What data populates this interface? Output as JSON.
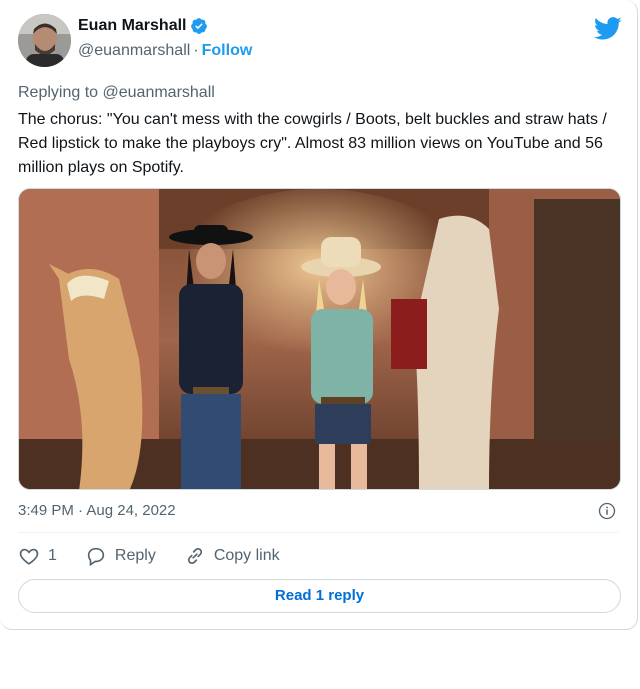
{
  "author": {
    "name": "Euan Marshall",
    "handle": "@euanmarshall",
    "separator": "·",
    "follow_label": "Follow"
  },
  "tweet": {
    "replying_prefix": "Replying to",
    "replying_handle": "@euanmarshall",
    "text": "The chorus: \"You can't mess with the cowgirls / Boots, belt buckles and straw hats / Red lipstick to make the playboys cry\". Almost 83 million views on YouTube and 56 million plays on Spotify.",
    "timestamp": "3:49 PM · Aug 24, 2022"
  },
  "actions": {
    "like_count": "1",
    "reply_label": "Reply",
    "copy_label": "Copy link"
  },
  "read_replies_label": "Read 1 reply",
  "colors": {
    "accent": "#1d9bf0",
    "link_button": "#006fd6",
    "muted": "#536471",
    "border": "#cfd9de"
  }
}
